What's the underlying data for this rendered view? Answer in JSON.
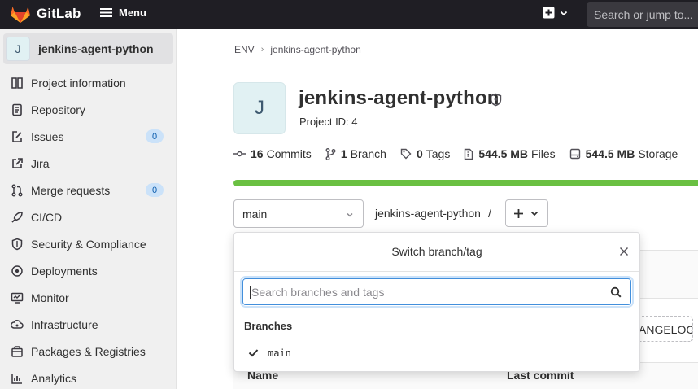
{
  "topbar": {
    "brand": "GitLab",
    "menu_label": "Menu",
    "search_placeholder": "Search or jump to..."
  },
  "sidebar": {
    "project_avatar_letter": "J",
    "project_name": "jenkins-agent-python",
    "items": [
      {
        "label": "Project information",
        "icon": "info-doc-icon"
      },
      {
        "label": "Repository",
        "icon": "repository-icon"
      },
      {
        "label": "Issues",
        "icon": "issues-icon",
        "count": "0"
      },
      {
        "label": "Jira",
        "icon": "external-link-icon"
      },
      {
        "label": "Merge requests",
        "icon": "merge-request-icon",
        "count": "0"
      },
      {
        "label": "CI/CD",
        "icon": "rocket-icon"
      },
      {
        "label": "Security & Compliance",
        "icon": "shield-icon"
      },
      {
        "label": "Deployments",
        "icon": "deployments-icon"
      },
      {
        "label": "Monitor",
        "icon": "monitor-icon"
      },
      {
        "label": "Infrastructure",
        "icon": "cloud-gear-icon"
      },
      {
        "label": "Packages & Registries",
        "icon": "package-icon"
      },
      {
        "label": "Analytics",
        "icon": "chart-icon"
      }
    ]
  },
  "breadcrumb": {
    "items": [
      "ENV",
      "jenkins-agent-python"
    ]
  },
  "project": {
    "avatar_letter": "J",
    "title": "jenkins-agent-python",
    "id_text": "Project ID: 4"
  },
  "stats": {
    "commits": {
      "value": "16",
      "label": "Commits"
    },
    "branches": {
      "value": "1",
      "label": "Branch"
    },
    "tags": {
      "value": "0",
      "label": "Tags"
    },
    "files": {
      "value": "544.5 MB",
      "label": "Files"
    },
    "storage": {
      "value": "544.5 MB",
      "label": "Storage"
    }
  },
  "storage_bar": {
    "fill_fraction": 1.0,
    "color": "#6ac042"
  },
  "repo_toolbar": {
    "branch": "main",
    "path_root": "jenkins-agent-python",
    "path_separator": "/"
  },
  "background": {
    "changelog_partial": "ANGELOG",
    "table_headers": [
      "Name",
      "Last commit"
    ]
  },
  "dropdown": {
    "title": "Switch branch/tag",
    "search_placeholder": "Search branches and tags",
    "section_label": "Branches",
    "branches": [
      {
        "name": "main",
        "selected": true
      }
    ]
  },
  "colors": {
    "topbar_bg": "#1f1e24",
    "sidebar_bg": "#f0f0f0",
    "accent_focus": "#428fdc",
    "badge_bg": "#cbe2f9"
  }
}
